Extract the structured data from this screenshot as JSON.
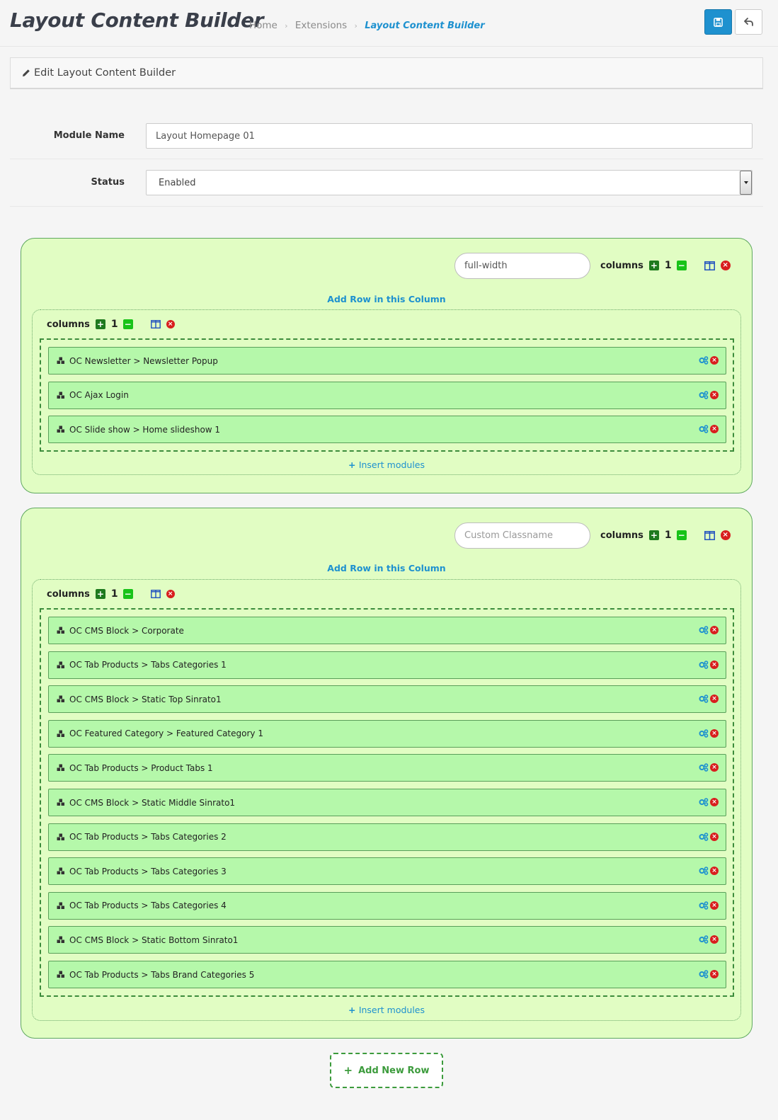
{
  "header": {
    "title": "Layout Content Builder",
    "breadcrumb": [
      "Home",
      "Extensions",
      "Layout Content Builder"
    ],
    "breadcrumb_separator": "›"
  },
  "panel": {
    "heading": "Edit Layout Content Builder"
  },
  "form": {
    "module_name_label": "Module Name",
    "module_name_value": "Layout Homepage 01",
    "status_label": "Status",
    "status_value": "Enabled"
  },
  "rows": [
    {
      "classname_value": "full-width",
      "classname_placeholder": "Custom Classname",
      "columns_label": "columns",
      "columns_count": "1",
      "add_row_link": "Add Row in this Column",
      "column": {
        "columns_label": "columns",
        "columns_count": "1",
        "modules": [
          "OC Newsletter > Newsletter Popup",
          "OC Ajax Login",
          "OC Slide show > Home slideshow 1"
        ],
        "insert_label": "Insert modules"
      }
    },
    {
      "classname_value": "",
      "classname_placeholder": "Custom Classname",
      "columns_label": "columns",
      "columns_count": "1",
      "add_row_link": "Add Row in this Column",
      "column": {
        "columns_label": "columns",
        "columns_count": "1",
        "modules": [
          "OC CMS Block > Corporate",
          "OC Tab Products > Tabs Categories 1",
          "OC CMS Block > Static Top Sinrato1",
          "OC Featured Category > Featured Category 1",
          "OC Tab Products > Product Tabs 1",
          "OC CMS Block > Static Middle Sinrato1",
          "OC Tab Products > Tabs Categories 2",
          "OC Tab Products > Tabs Categories 3",
          "OC Tab Products > Tabs Categories 4",
          "OC CMS Block > Static Bottom Sinrato1",
          "OC Tab Products > Tabs Brand Categories 5"
        ],
        "insert_label": "Insert modules"
      }
    }
  ],
  "add_new_row_label": "Add New Row",
  "icons": {
    "save": "save-icon",
    "back": "reply-icon",
    "edit": "pencil-icon",
    "module": "cubes-icon",
    "settings": "cogs-icon",
    "remove": "times-circle-icon",
    "layout": "columns-icon",
    "add": "plus-square-icon",
    "reduce": "minus-square-icon"
  },
  "colors": {
    "accent": "#1e91cf",
    "row_bg": "#e1fdc3",
    "module_bg": "#b5f8aa",
    "danger": "#d81e1e"
  }
}
